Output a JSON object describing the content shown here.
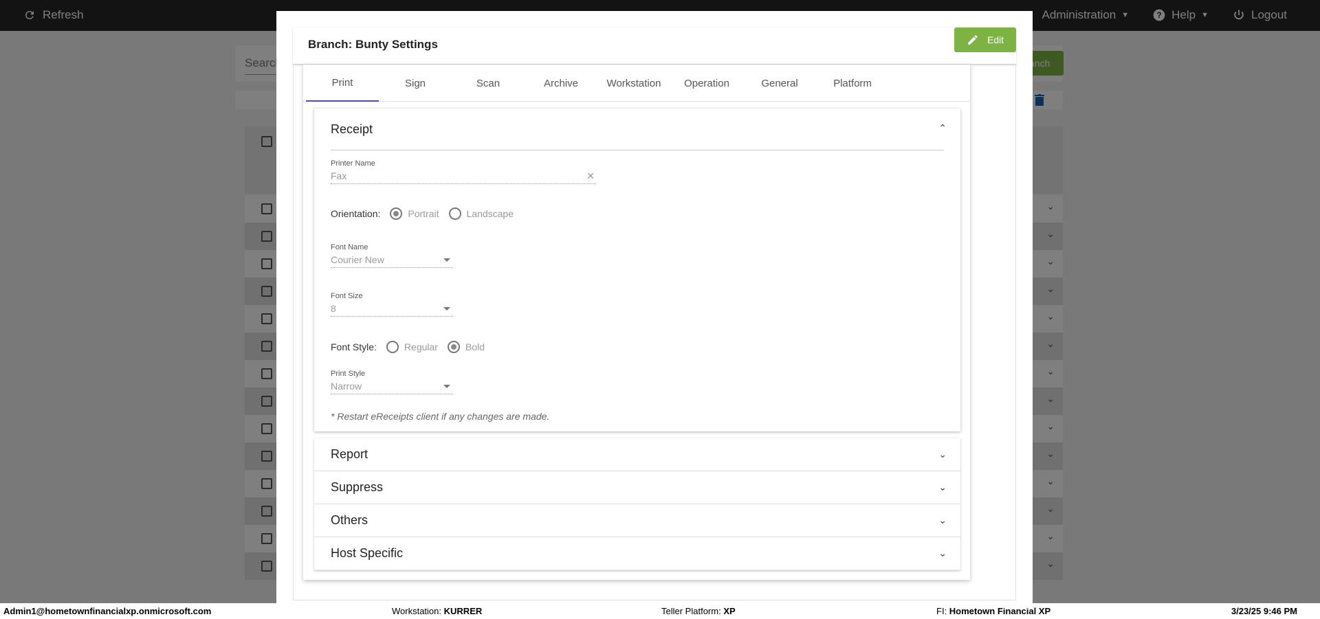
{
  "topbar": {
    "refresh_label": "Refresh",
    "administration_label": "Administration",
    "help_label": "Help",
    "logout_label": "Logout"
  },
  "background": {
    "search_placeholder": "Search",
    "button_fragment": "anch"
  },
  "modal": {
    "title": "Branch: Bunty Settings",
    "edit_label": "Edit",
    "tabs": [
      "Print",
      "Sign",
      "Scan",
      "Archive",
      "Workstation",
      "Operation",
      "General",
      "Platform"
    ],
    "active_tab": "Print",
    "receipt": {
      "title": "Receipt",
      "printer_name_label": "Printer Name",
      "printer_name_value": "Fax",
      "orientation_label": "Orientation:",
      "orientation_options": [
        "Portrait",
        "Landscape"
      ],
      "orientation_selected": "Portrait",
      "font_name_label": "Font Name",
      "font_name_value": "Courier New",
      "font_size_label": "Font Size",
      "font_size_value": "8",
      "font_style_label": "Font Style:",
      "font_style_options": [
        "Regular",
        "Bold"
      ],
      "font_style_selected": "Bold",
      "print_style_label": "Print Style",
      "print_style_value": "Narrow",
      "note": "* Restart eReceipts client if any changes are made."
    },
    "collapsed_sections": [
      "Report",
      "Suppress",
      "Others",
      "Host Specific"
    ]
  },
  "statusbar": {
    "user": "Admin1@hometownfinancialxp.onmicrosoft.com",
    "workstation_label": "Workstation:",
    "workstation_value": "KURRER",
    "teller_label": "Teller Platform:",
    "teller_value": "XP",
    "fi_label": "FI:",
    "fi_value": "Hometown Financial XP",
    "datetime": "3/23/25 9:46 PM"
  },
  "colors": {
    "topbar_bg": "#262626",
    "accent_green": "#7cb342",
    "tab_indicator": "#3f51b5"
  }
}
